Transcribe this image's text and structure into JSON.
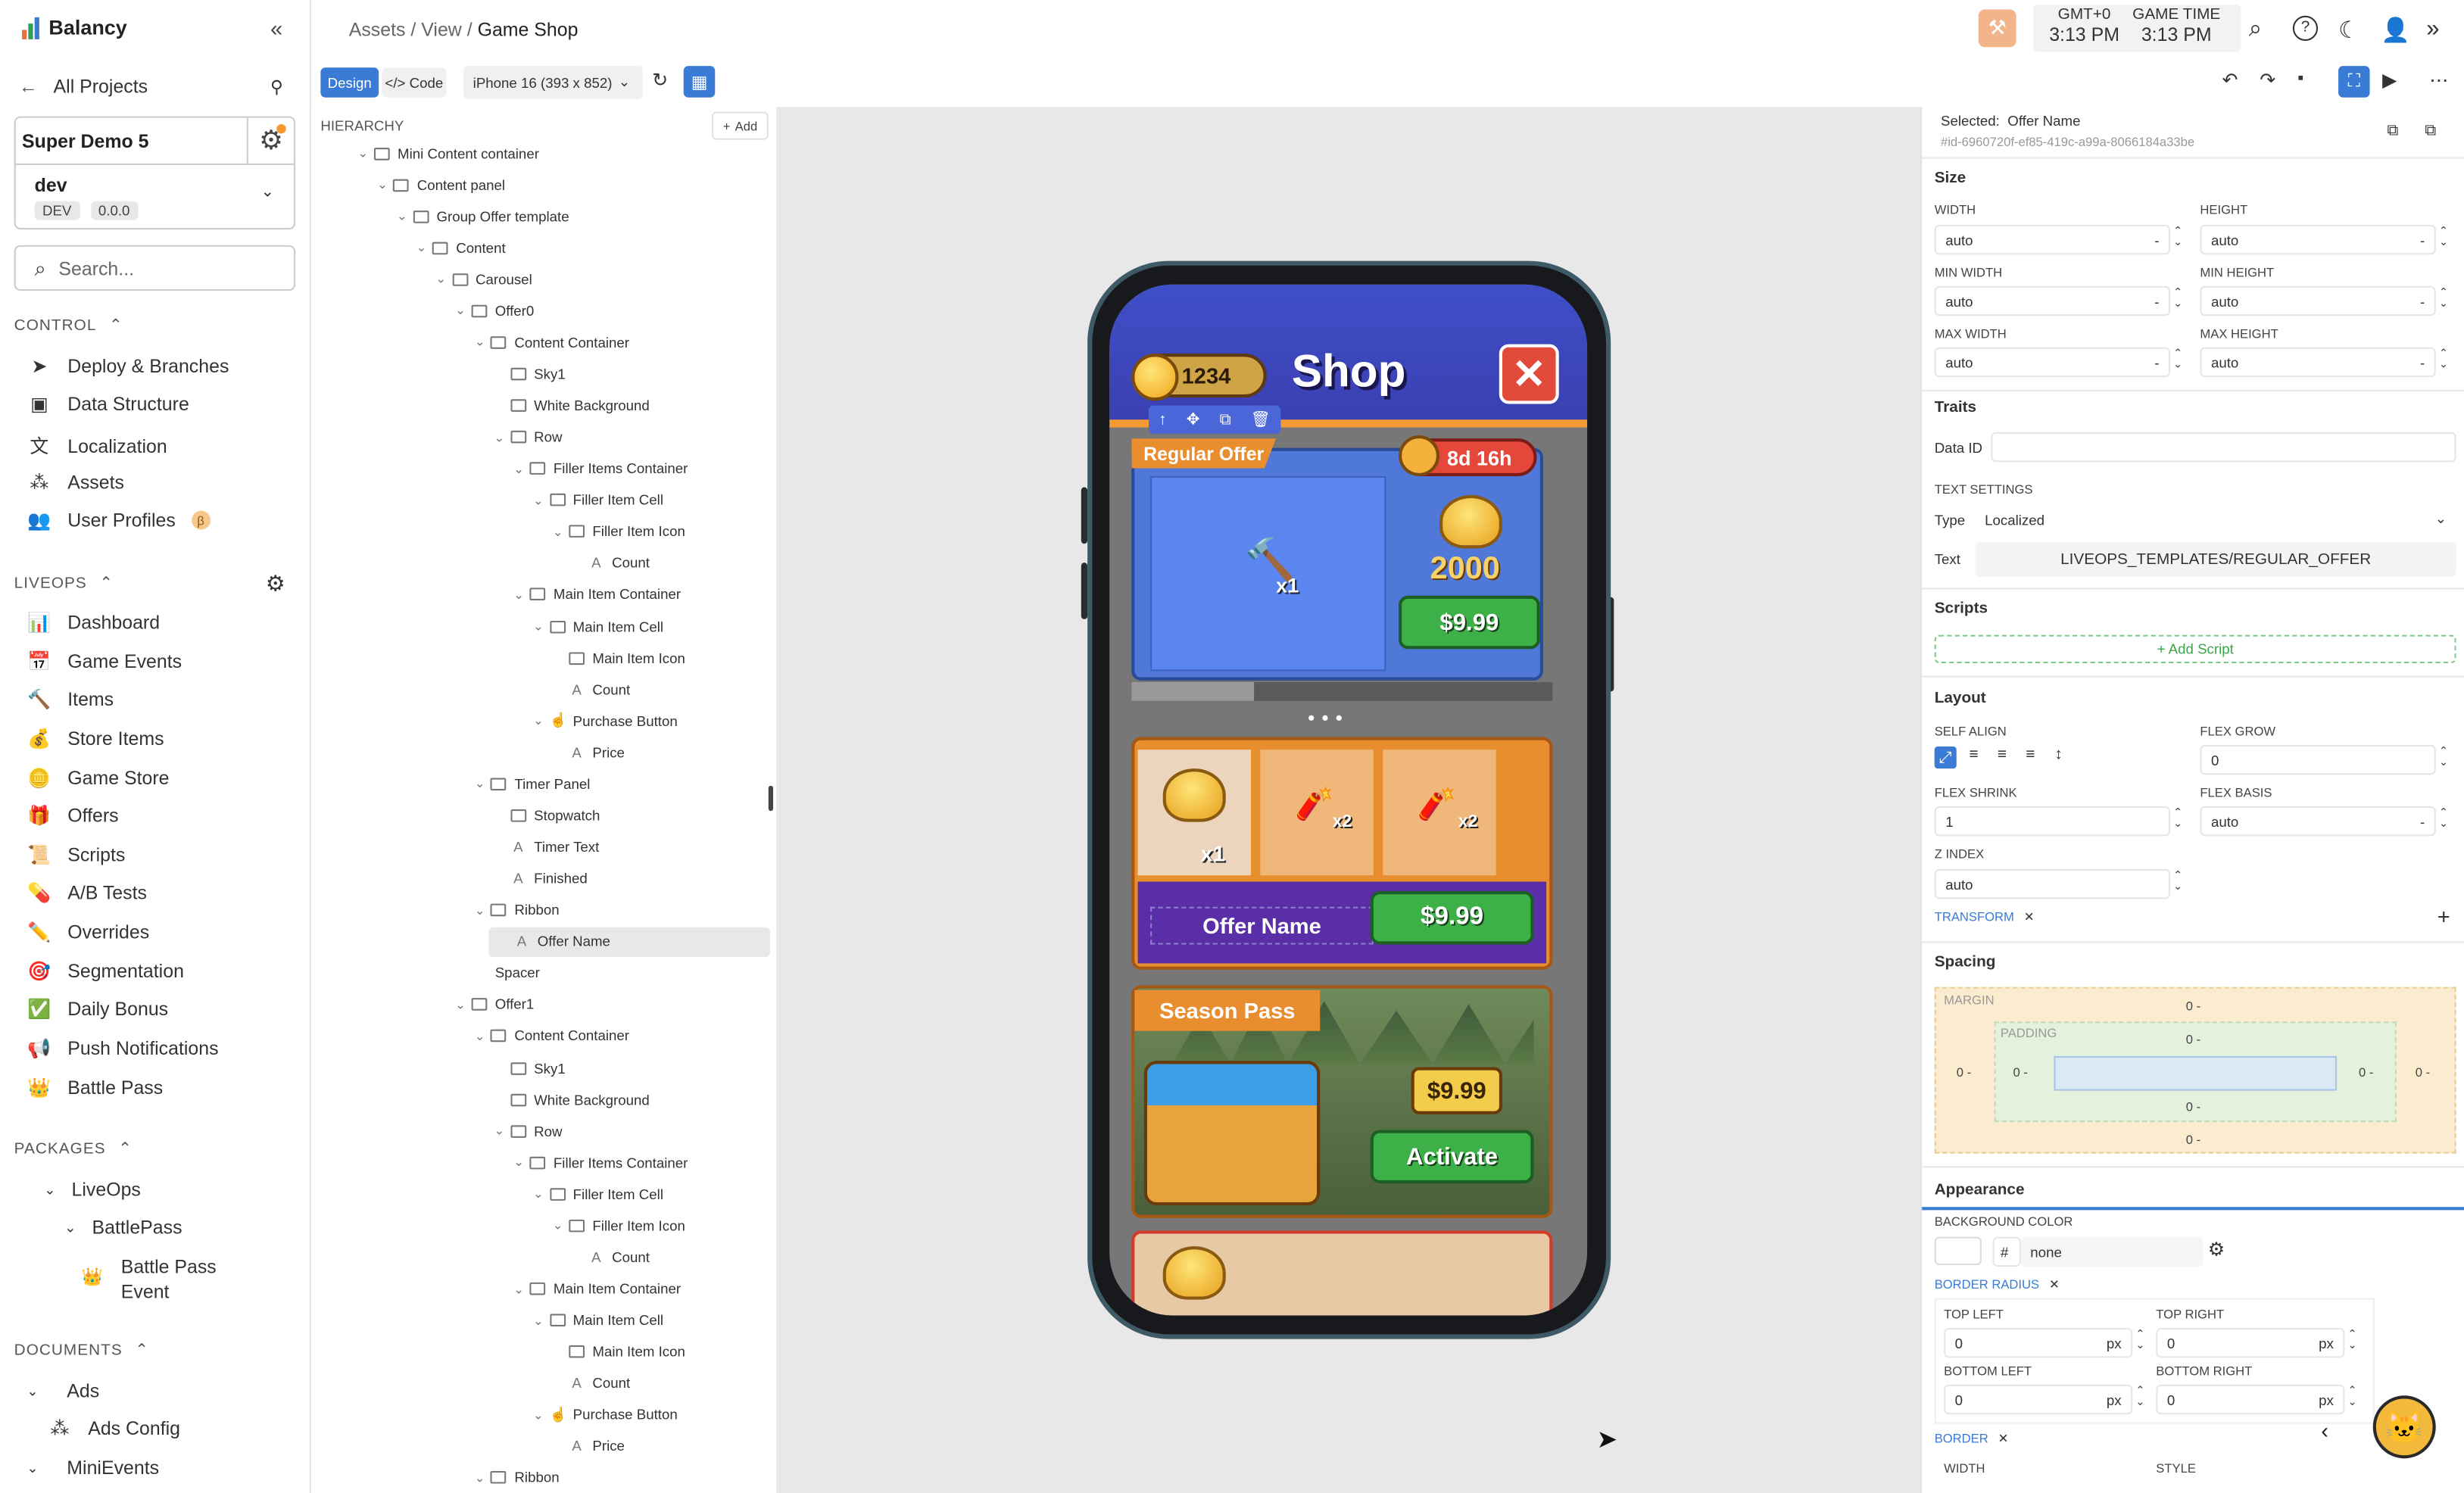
{
  "app": {
    "name": "Balancy"
  },
  "sidebar": {
    "all_projects": "All Projects",
    "project": {
      "name": "Super Demo 5",
      "branch": "dev",
      "env": "DEV",
      "version": "0.0.0"
    },
    "search_placeholder": "Search...",
    "control": {
      "title": "CONTROL",
      "items": [
        "Deploy & Branches",
        "Data Structure",
        "Localization",
        "Assets",
        "User Profiles"
      ],
      "beta_mark": "β"
    },
    "liveops": {
      "title": "LIVEOPS",
      "items": [
        "Dashboard",
        "Game Events",
        "Items",
        "Store Items",
        "Game Store",
        "Offers",
        "Scripts",
        "A/B Tests",
        "Overrides",
        "Segmentation",
        "Daily Bonus",
        "Push Notifications",
        "Battle Pass"
      ]
    },
    "packages": {
      "title": "PACKAGES",
      "items": [
        "LiveOps",
        "BattlePass",
        "Battle Pass",
        "Event"
      ]
    },
    "documents": {
      "title": "DOCUMENTS",
      "items": [
        "Ads",
        "Ads Config",
        "MiniEvents"
      ]
    }
  },
  "header": {
    "breadcrumb": [
      "Assets",
      "View",
      "Game Shop"
    ],
    "tz_label": "GMT+0",
    "tz_time": "3:13 PM",
    "game_time_label": "GAME TIME",
    "game_time": "3:13 PM"
  },
  "toolbar": {
    "design": "Design",
    "code": "</> Code",
    "device": "iPhone 16  (393 x 852)"
  },
  "hierarchy": {
    "title": "HIERARCHY",
    "add": "Add",
    "rows": [
      {
        "d": 0,
        "t": "b",
        "label": "Mini Content container"
      },
      {
        "d": 1,
        "t": "b",
        "label": "Content panel"
      },
      {
        "d": 2,
        "t": "b",
        "label": "Group Offer template"
      },
      {
        "d": 3,
        "t": "b",
        "label": "Content"
      },
      {
        "d": 4,
        "t": "b",
        "label": "Carousel"
      },
      {
        "d": 5,
        "t": "i",
        "label": "Offer0"
      },
      {
        "d": 6,
        "t": "b",
        "label": "Content Container"
      },
      {
        "d": 7,
        "t": "i",
        "label": "Sky1",
        "leaf": true
      },
      {
        "d": 7,
        "t": "i",
        "label": "White Background",
        "leaf": true
      },
      {
        "d": 7,
        "t": "b",
        "label": "Row"
      },
      {
        "d": 8,
        "t": "b",
        "label": "Filler Items Container"
      },
      {
        "d": 9,
        "t": "b",
        "label": "Filler Item Cell"
      },
      {
        "d": 10,
        "t": "i",
        "label": "Filler Item Icon"
      },
      {
        "d": 11,
        "t": "a",
        "label": "Count",
        "leaf": true
      },
      {
        "d": 8,
        "t": "b",
        "label": "Main Item Container"
      },
      {
        "d": 9,
        "t": "b",
        "label": "Main Item Cell"
      },
      {
        "d": 10,
        "t": "i",
        "label": "Main Item Icon",
        "leaf": true
      },
      {
        "d": 10,
        "t": "a",
        "label": "Count",
        "leaf": true
      },
      {
        "d": 9,
        "t": "p",
        "label": "Purchase Button"
      },
      {
        "d": 10,
        "t": "a",
        "label": "Price",
        "leaf": true
      },
      {
        "d": 6,
        "t": "i",
        "label": "Timer Panel"
      },
      {
        "d": 7,
        "t": "i",
        "label": "Stopwatch",
        "leaf": true
      },
      {
        "d": 7,
        "t": "a",
        "label": "Timer Text",
        "leaf": true
      },
      {
        "d": 7,
        "t": "a",
        "label": "Finished",
        "leaf": true
      },
      {
        "d": 6,
        "t": "i",
        "label": "Ribbon"
      },
      {
        "d": 7,
        "t": "a",
        "label": "Offer Name",
        "leaf": true,
        "sel": true
      },
      {
        "d": 5,
        "t": "n",
        "label": "Spacer",
        "leaf": true
      },
      {
        "d": 5,
        "t": "i",
        "label": "Offer1"
      },
      {
        "d": 6,
        "t": "b",
        "label": "Content Container"
      },
      {
        "d": 7,
        "t": "i",
        "label": "Sky1",
        "leaf": true
      },
      {
        "d": 7,
        "t": "i",
        "label": "White Background",
        "leaf": true
      },
      {
        "d": 7,
        "t": "b",
        "label": "Row"
      },
      {
        "d": 8,
        "t": "b",
        "label": "Filler Items Container"
      },
      {
        "d": 9,
        "t": "b",
        "label": "Filler Item Cell"
      },
      {
        "d": 10,
        "t": "i",
        "label": "Filler Item Icon"
      },
      {
        "d": 11,
        "t": "a",
        "label": "Count",
        "leaf": true
      },
      {
        "d": 8,
        "t": "b",
        "label": "Main Item Container"
      },
      {
        "d": 9,
        "t": "b",
        "label": "Main Item Cell"
      },
      {
        "d": 10,
        "t": "i",
        "label": "Main Item Icon",
        "leaf": true
      },
      {
        "d": 10,
        "t": "a",
        "label": "Count",
        "leaf": true
      },
      {
        "d": 9,
        "t": "p",
        "label": "Purchase Button"
      },
      {
        "d": 10,
        "t": "a",
        "label": "Price",
        "leaf": true
      },
      {
        "d": 6,
        "t": "i",
        "label": "Ribbon"
      }
    ]
  },
  "preview": {
    "coins": "1234",
    "title": "Shop",
    "offer1": {
      "ribbon": "Regular Offer",
      "timer": "8d 16h",
      "gold": "2000",
      "price": "$9.99",
      "item_count": "x1"
    },
    "offer2": {
      "name": "Offer Name",
      "price": "$9.99",
      "c1": "x1",
      "c2": "x2",
      "c3": "x2"
    },
    "season": {
      "title": "Season Pass",
      "price": "$9.99",
      "cta": "Activate"
    }
  },
  "props": {
    "selected_label": "Selected:",
    "selected_name": "Offer Name",
    "id": "#id-6960720f-ef85-419c-a99a-8066184a33be",
    "size": {
      "title": "Size",
      "width_label": "WIDTH",
      "width": "auto",
      "height_label": "HEIGHT",
      "height": "auto",
      "min_width_label": "MIN WIDTH",
      "min_width": "auto",
      "min_height_label": "MIN HEIGHT",
      "min_height": "auto",
      "max_width_label": "MAX WIDTH",
      "max_width": "auto",
      "max_height_label": "MAX HEIGHT",
      "max_height": "auto"
    },
    "traits": {
      "title": "Traits",
      "data_id_label": "Data ID"
    },
    "text_settings": {
      "title": "TEXT SETTINGS",
      "type_label": "Type",
      "type": "Localized",
      "text_label": "Text",
      "text": "LIVEOPS_TEMPLATES/REGULAR_OFFER"
    },
    "scripts": {
      "title": "Scripts",
      "add": "+ Add Script"
    },
    "layout": {
      "title": "Layout",
      "self_align": "SELF ALIGN",
      "flex_grow_label": "FLEX GROW",
      "flex_grow": "0",
      "flex_shrink_label": "FLEX SHRINK",
      "flex_shrink": "1",
      "flex_basis_label": "FLEX BASIS",
      "flex_basis": "auto",
      "z_index_label": "Z INDEX",
      "z_index": "auto",
      "transform": "TRANSFORM"
    },
    "spacing": {
      "title": "Spacing",
      "margin": "MARGIN",
      "padding": "PADDING",
      "zero": "0 -"
    },
    "appearance": {
      "title": "Appearance",
      "bg_label": "BACKGROUND COLOR",
      "hash": "#",
      "bg": "none",
      "border_radius": "BORDER RADIUS",
      "tl": "TOP LEFT",
      "tr": "TOP RIGHT",
      "bl": "BOTTOM LEFT",
      "br": "BOTTOM RIGHT",
      "radius_val": "0",
      "px": "px",
      "border": "BORDER",
      "width": "WIDTH",
      "style": "STYLE"
    }
  },
  "colors": {
    "accent": "#3a7bd5",
    "selection": "#4a66d9",
    "brand": "#e8733a"
  }
}
